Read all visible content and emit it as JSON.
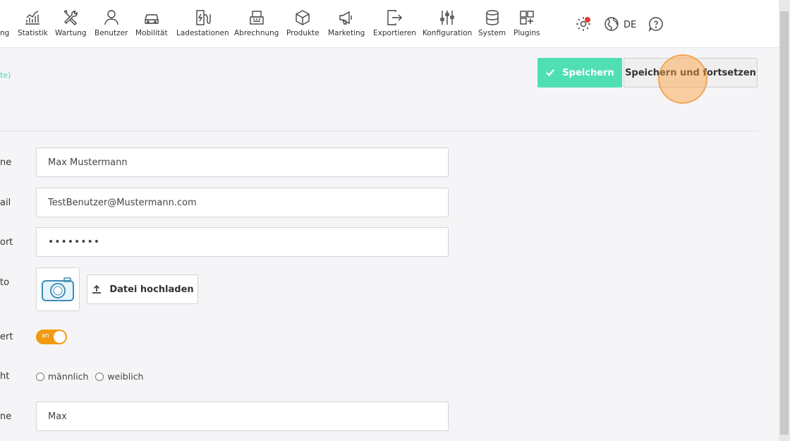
{
  "nav": {
    "partial_label": "ng",
    "items": [
      {
        "label": "Statistik",
        "icon": "chart-icon"
      },
      {
        "label": "Wartung",
        "icon": "tools-icon"
      },
      {
        "label": "Benutzer",
        "icon": "user-icon"
      },
      {
        "label": "Mobilität",
        "icon": "car-icon"
      },
      {
        "label": "Ladestationen",
        "icon": "charging-station-icon"
      },
      {
        "label": "Abrechnung",
        "icon": "cash-register-icon"
      },
      {
        "label": "Produkte",
        "icon": "box-icon"
      },
      {
        "label": "Marketing",
        "icon": "megaphone-icon"
      },
      {
        "label": "Exportieren",
        "icon": "export-icon"
      },
      {
        "label": "Konfiguration",
        "icon": "sliders-icon"
      },
      {
        "label": "System",
        "icon": "database-icon"
      },
      {
        "label": "Plugins",
        "icon": "plugins-icon"
      }
    ]
  },
  "header": {
    "language": "DE",
    "settings_icon": "gear-icon",
    "globe_icon": "globe-icon",
    "help_icon": "help-bubble-icon"
  },
  "link_fragment": "te)",
  "actions": {
    "save_label": "Speichern",
    "save_continue_label": "Speichern und fortsetzen"
  },
  "form": {
    "name": {
      "label_fragment": "ne",
      "value": "Max Mustermann"
    },
    "email": {
      "label_fragment": "ail",
      "value": "TestBenutzer@Mustermann.com"
    },
    "password": {
      "label_fragment": "ort",
      "value": "••••••••"
    },
    "photo": {
      "label_fragment": "to",
      "upload_label": "Datei hochladen"
    },
    "active": {
      "label_fragment": "ert",
      "toggle_label": "an",
      "state": true
    },
    "gender": {
      "label_fragment": "ht",
      "options": [
        "männlich",
        "weiblich"
      ]
    },
    "firstname": {
      "label_fragment": "ne",
      "value": "Max"
    }
  },
  "colors": {
    "accent_green": "#50dfb5",
    "toggle_orange": "#f29a12"
  }
}
